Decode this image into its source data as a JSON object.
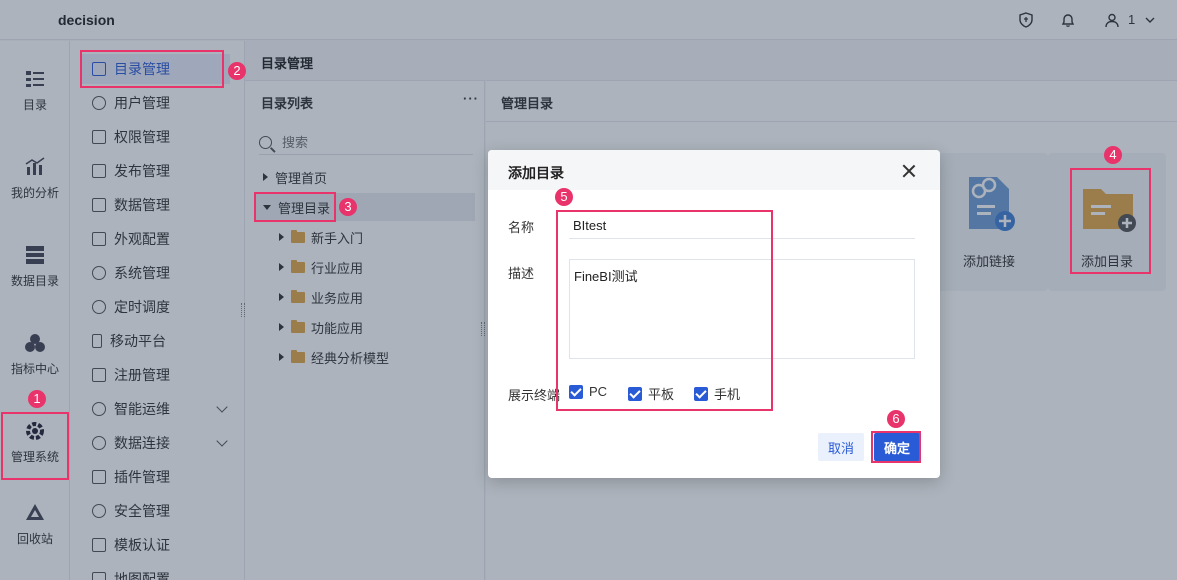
{
  "app": {
    "title": "decision",
    "user_label": "1"
  },
  "iconbar": [
    {
      "label": "目录",
      "icon": "catalog-icon"
    },
    {
      "label": "我的分析",
      "icon": "analysis-icon"
    },
    {
      "label": "数据目录",
      "icon": "data-catalog-icon"
    },
    {
      "label": "指标中心",
      "icon": "metrics-icon"
    },
    {
      "label": "管理系统",
      "icon": "gear-icon"
    },
    {
      "label": "回收站",
      "icon": "recycle-icon"
    }
  ],
  "menu": [
    {
      "label": "目录管理",
      "active": true
    },
    {
      "label": "用户管理"
    },
    {
      "label": "权限管理"
    },
    {
      "label": "发布管理"
    },
    {
      "label": "数据管理"
    },
    {
      "label": "外观配置"
    },
    {
      "label": "系统管理"
    },
    {
      "label": "定时调度"
    },
    {
      "label": "移动平台"
    },
    {
      "label": "注册管理"
    },
    {
      "label": "智能运维",
      "expandable": true
    },
    {
      "label": "数据连接",
      "expandable": true
    },
    {
      "label": "插件管理"
    },
    {
      "label": "安全管理"
    },
    {
      "label": "模板认证"
    },
    {
      "label": "地图配置"
    }
  ],
  "breadcrumb": "目录管理",
  "tree_panel": {
    "title": "目录列表",
    "more": "···",
    "search_placeholder": "搜索",
    "rows": [
      {
        "label": "管理首页",
        "level": 0,
        "expanded": false
      },
      {
        "label": "管理目录",
        "level": 0,
        "expanded": true,
        "selected": true
      },
      {
        "label": "新手入门",
        "level": 1
      },
      {
        "label": "行业应用",
        "level": 1
      },
      {
        "label": "业务应用",
        "level": 1
      },
      {
        "label": "功能应用",
        "level": 1
      },
      {
        "label": "经典分析模型",
        "level": 1
      }
    ]
  },
  "main_panel": {
    "title": "管理目录",
    "cards": [
      {
        "label": "添加链接",
        "icon": "add-link-icon"
      },
      {
        "label": "添加目录",
        "icon": "add-folder-icon"
      }
    ]
  },
  "dialog": {
    "title": "添加目录",
    "name_label": "名称",
    "name_value": "BItest",
    "desc_label": "描述",
    "desc_value": "FineBI测试",
    "terminal_label": "展示终端",
    "terminals": [
      "PC",
      "平板",
      "手机"
    ],
    "cancel_label": "取消",
    "ok_label": "确定"
  },
  "annotations": [
    "1",
    "2",
    "3",
    "4",
    "5",
    "6"
  ],
  "colors": {
    "accent": "#2a5bd7",
    "highlight": "#e8336b",
    "folder": "#e0a84a"
  }
}
